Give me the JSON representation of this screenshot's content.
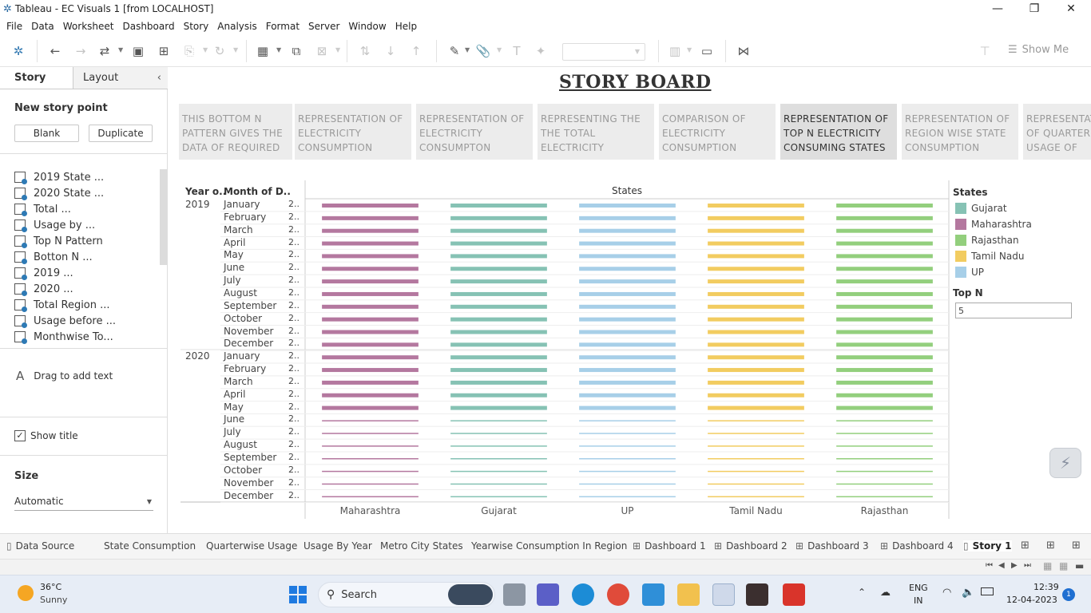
{
  "window": {
    "title": "Tableau - EC Visuals 1 [from LOCALHOST]"
  },
  "menu": [
    "File",
    "Data",
    "Worksheet",
    "Dashboard",
    "Story",
    "Analysis",
    "Format",
    "Server",
    "Window",
    "Help"
  ],
  "toolbar": {
    "show_me": "Show Me"
  },
  "left_pane": {
    "tabs": [
      "Story",
      "Layout"
    ],
    "new_story_point": "New story point",
    "blank": "Blank",
    "duplicate": "Duplicate",
    "sheets": [
      "2019 State ...",
      "2020 State ...",
      "Total ...",
      "Usage by ...",
      "Top N Pattern",
      "Botton N ...",
      "2019 ...",
      "2020 ...",
      "Total Region ...",
      "Usage before ...",
      "Monthwise To..."
    ],
    "drag_text": "Drag to add text",
    "show_title": "Show title",
    "size_label": "Size",
    "size_value": "Automatic"
  },
  "story": {
    "title": "STORY BOARD",
    "points": [
      "THIS BOTTOM N PATTERN GIVES THE DATA OF REQUIRED",
      "REPRESENTATION OF ELECTRICITY CONSUMPTION",
      "REPRESENTATION OF ELECTRICITY CONSUMPTON",
      "REPRESENTING THE THE TOTAL ELECTRICITY",
      "COMPARISON OF ELECTRICITY CONSUMPTION",
      "REPRESENTATION OF TOP N ELECTRICITY CONSUMING STATES",
      "REPRESENTATION OF REGION WISE STATE CONSUMPTION",
      "REPRESENTATION OF QUARTER USAGE OF"
    ],
    "active_point": 5
  },
  "chart_data": {
    "type": "bar",
    "header_year": "Year o..",
    "header_month": "Month of D..",
    "header_col": "States",
    "years": [
      "2019",
      "2020"
    ],
    "months": [
      "January",
      "February",
      "March",
      "April",
      "May",
      "June",
      "July",
      "August",
      "September",
      "October",
      "November",
      "December"
    ],
    "row_value_label": "2..",
    "columns": [
      "Maharashtra",
      "Gujarat",
      "UP",
      "Tamil Nadu",
      "Rajasthan"
    ],
    "topn_active_2020_months": 5
  },
  "legend": {
    "title": "States",
    "items": [
      {
        "name": "Gujarat",
        "color": "#86c2b4"
      },
      {
        "name": "Maharashtra",
        "color": "#b4789f"
      },
      {
        "name": "Rajasthan",
        "color": "#93cf7d"
      },
      {
        "name": "Tamil Nadu",
        "color": "#f2cc60"
      },
      {
        "name": "UP",
        "color": "#a7cfe8"
      }
    ],
    "topn_label": "Top N",
    "topn_value": "5"
  },
  "bottom_tabs": [
    "Data Source",
    "State Consumption",
    "Quarterwise Usage",
    "Usage By Year",
    "Metro City States",
    "Yearwise Consumption In Region",
    "Dashboard 1",
    "Dashboard 2",
    "Dashboard 3",
    "Dashboard 4",
    "Story 1"
  ],
  "taskbar": {
    "temp": "36°C",
    "weather": "Sunny",
    "search": "Search",
    "lang1": "ENG",
    "lang2": "IN",
    "time": "12:39",
    "date": "12-04-2023",
    "notif": "1"
  }
}
